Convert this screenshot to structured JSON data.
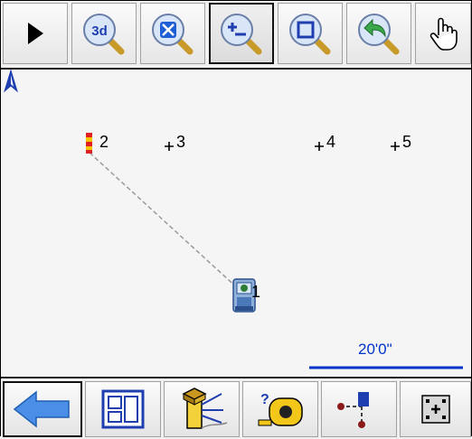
{
  "toolbar_top": {
    "buttons": [
      {
        "name": "play-icon"
      },
      {
        "name": "view-3d-icon",
        "badge": "3d"
      },
      {
        "name": "zoom-extents-icon"
      },
      {
        "name": "zoom-in-out-icon",
        "active": true
      },
      {
        "name": "zoom-window-icon"
      },
      {
        "name": "zoom-previous-icon"
      },
      {
        "name": "pan-hand-icon"
      }
    ]
  },
  "map": {
    "points": [
      {
        "label": "1",
        "marker": "total-station-icon"
      },
      {
        "label": "2",
        "marker": "backsight-target-icon"
      },
      {
        "label": "3",
        "marker": "cross-icon"
      },
      {
        "label": "4",
        "marker": "cross-icon"
      },
      {
        "label": "5",
        "marker": "cross-icon"
      }
    ],
    "north_arrow": "north-arrow-icon",
    "scale_bar_label": "20'0\""
  },
  "toolbar_bottom": {
    "buttons": [
      {
        "name": "back-arrow-icon"
      },
      {
        "name": "map-layers-icon"
      },
      {
        "name": "stakeout-icon"
      },
      {
        "name": "measure-tape-icon",
        "badge": "?"
      },
      {
        "name": "cogo-point-icon"
      },
      {
        "name": "point-options-icon"
      }
    ]
  },
  "colors": {
    "scale_bar": "#0033cc",
    "line": "#9a9a9a",
    "accent_blue": "#1f5fd6"
  }
}
